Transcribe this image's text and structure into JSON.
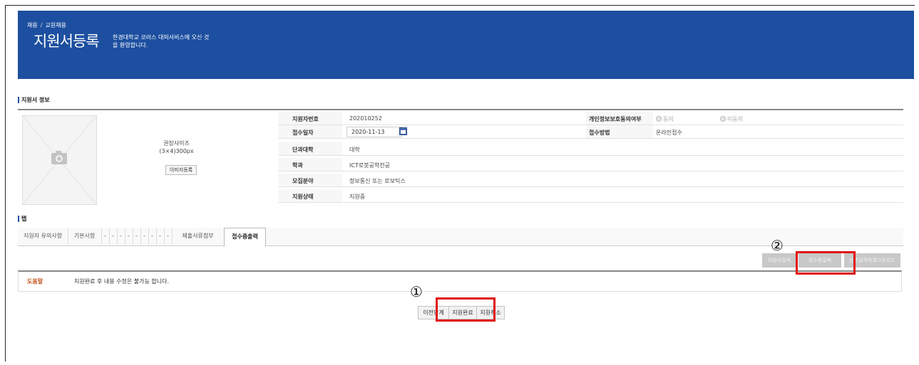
{
  "header": {
    "breadcrumb": [
      "채용",
      "교원채용"
    ],
    "breadcrumb_sep": "/",
    "title": "지원서등록",
    "welcome": "한경대학교 코러스 대외서비스에 오신 것을 환영합니다."
  },
  "applicant_info": {
    "section_title": "지원서 정보",
    "photo": {
      "recommend_size": "권장사이즈",
      "size_value": "(3×4)300px",
      "image_button": "이미지등록"
    },
    "applicant_no": {
      "label": "지원자번호",
      "value": "202010252"
    },
    "receipt_date": {
      "label": "접수일자",
      "value": "2020-11-13"
    },
    "college": {
      "label": "단과대학",
      "value": "대학"
    },
    "department": {
      "label": "학과",
      "value": "ICT로봇공학전공"
    },
    "field": {
      "label": "모집분야",
      "value": "정보통신 또는 로보틱스"
    },
    "status": {
      "label": "지원상태",
      "value": "지원중"
    },
    "privacy_consent": {
      "label": "개인정보보호동의여부",
      "agree": "동의",
      "disagree": "미동의"
    },
    "receipt_method": {
      "label": "접수방법",
      "value": "온라인접수"
    }
  },
  "tabs_section": {
    "section_title": "탭",
    "tabs": [
      {
        "label": "지원자 유의사항"
      },
      {
        "label": "기본사항"
      },
      {
        "label": "-"
      },
      {
        "label": "-"
      },
      {
        "label": "-"
      },
      {
        "label": "-"
      },
      {
        "label": "-"
      },
      {
        "label": "-"
      },
      {
        "label": "-"
      },
      {
        "label": "-"
      },
      {
        "label": "-"
      },
      {
        "label": "제출서류첨부"
      },
      {
        "label": "접수증출력"
      }
    ]
  },
  "right_buttons": [
    "지원서출력",
    "접수증출력",
    "논문실적목록다운로드"
  ],
  "help": {
    "label": "도움말",
    "text": "지원완료 후 내용 수정은 불가능 합니다."
  },
  "bottom_buttons": {
    "prev": "이전단계",
    "complete": "지원완료",
    "cancel": "지원취소"
  },
  "annotations": {
    "one": "①",
    "two": "②"
  },
  "colors": {
    "banner": "#1d4fa0",
    "highlight": "#e01010",
    "help_label": "#c04a12"
  }
}
